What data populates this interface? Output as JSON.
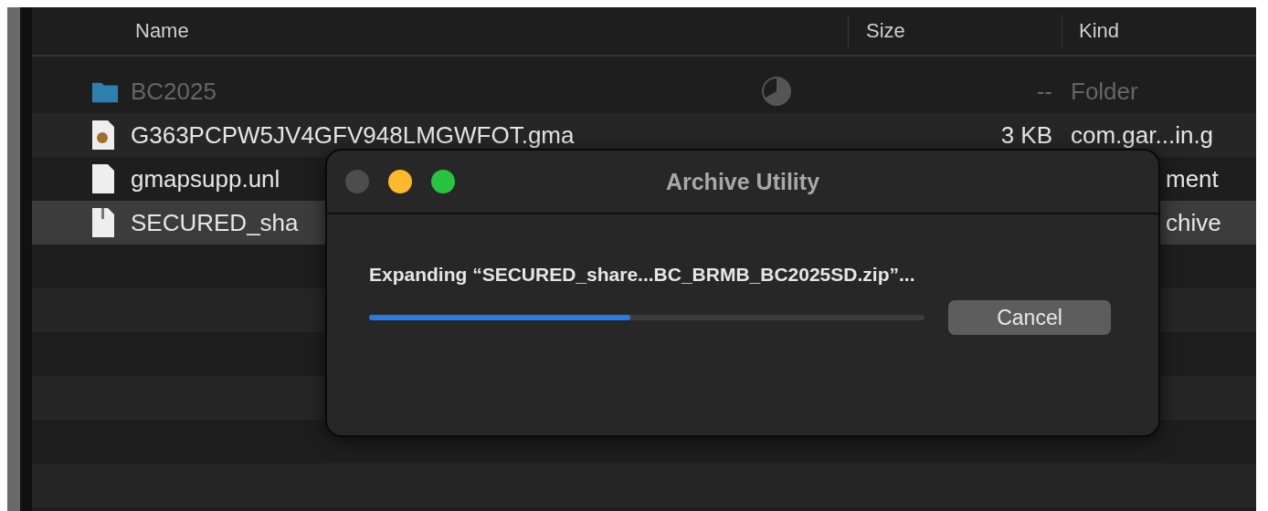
{
  "file_list": {
    "columns": [
      "Name",
      "Size",
      "Kind"
    ],
    "rows": [
      {
        "kind": "folder",
        "name": "BC2025",
        "size": "--",
        "type": "Folder",
        "dimmed": true,
        "downloading": true,
        "selected": false
      },
      {
        "kind": "image-document",
        "name": "G363PCPW5JV4GFV948LMGWFOT.gma",
        "size": "3 KB",
        "type": "com.gar...in.g",
        "dimmed": false,
        "downloading": false,
        "selected": false
      },
      {
        "kind": "document",
        "name": "gmapsupp.unl",
        "size": "",
        "type": "ment",
        "dimmed": false,
        "downloading": false,
        "selected": false
      },
      {
        "kind": "archive",
        "name": "SECURED_sha",
        "size": "",
        "type": "chive",
        "dimmed": false,
        "downloading": false,
        "selected": true
      }
    ]
  },
  "dialog": {
    "title": "Archive Utility",
    "message": "Expanding “SECURED_share...BC_BRMB_BC2025SD.zip”...",
    "progress": {
      "level": 0.47
    },
    "cancel_button": "Cancel"
  }
}
